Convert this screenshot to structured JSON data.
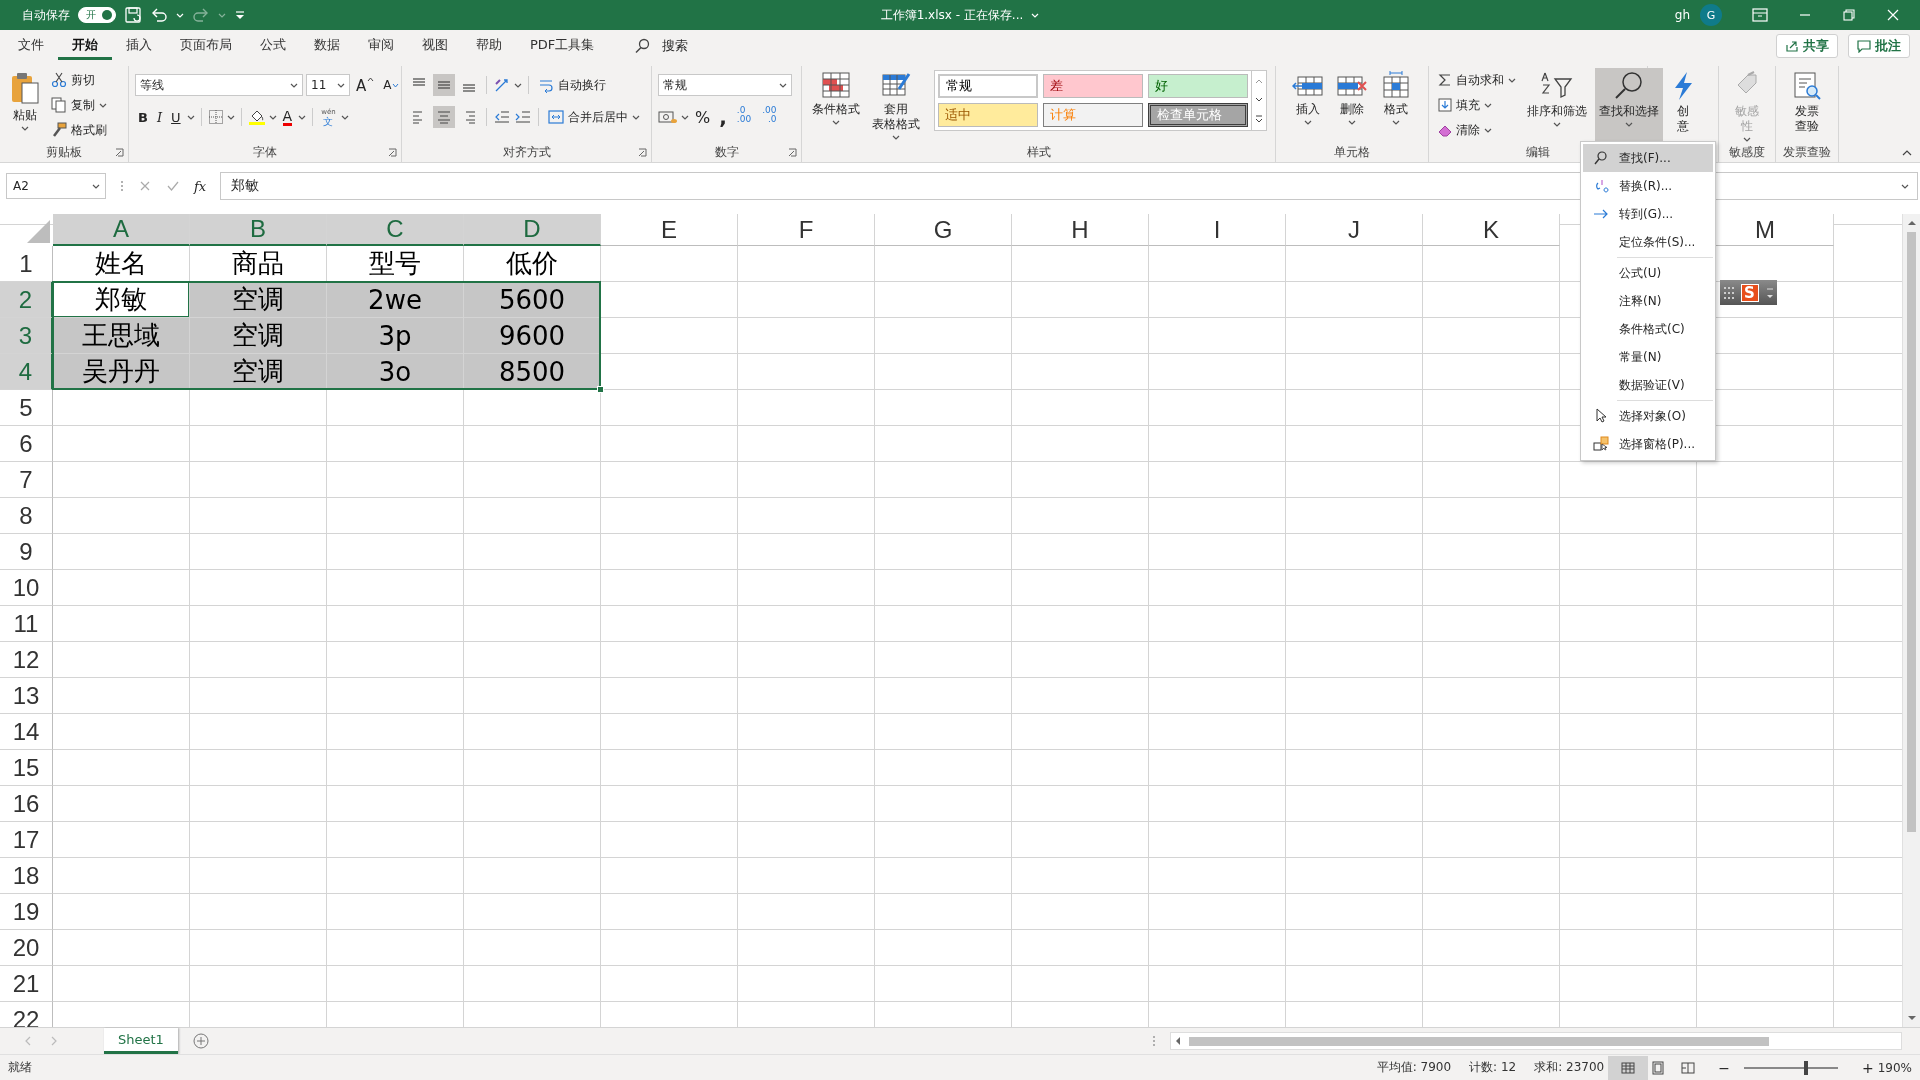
{
  "title_bar": {
    "autosave_label": "自动保存",
    "autosave_toggle": {
      "label": "开",
      "on": true
    },
    "redo_disabled": true,
    "title": "工作簿1.xlsx - 正在保存...",
    "user": "gh",
    "avatar": "G"
  },
  "tabs": [
    {
      "label": "文件",
      "selected": false
    },
    {
      "label": "开始",
      "selected": true
    },
    {
      "label": "插入",
      "selected": false
    },
    {
      "label": "页面布局",
      "selected": false
    },
    {
      "label": "公式",
      "selected": false
    },
    {
      "label": "数据",
      "selected": false
    },
    {
      "label": "审阅",
      "selected": false
    },
    {
      "label": "视图",
      "selected": false
    },
    {
      "label": "帮助",
      "selected": false
    },
    {
      "label": "PDF工具集",
      "selected": false
    }
  ],
  "search": {
    "label": "搜索"
  },
  "share_button": "共享",
  "comments_button": "批注",
  "ribbon": {
    "groups": [
      {
        "kind": "clipboard",
        "label": "剪贴板",
        "paste": "粘贴",
        "cut": "剪切",
        "copy": "复制",
        "format_painter": "格式刷"
      },
      {
        "kind": "font",
        "label": "字体",
        "font_name": "等线",
        "font_size": "11",
        "grow": "A",
        "shrink": "A",
        "bold": "B",
        "italic": "I",
        "underline": "U",
        "font_color": "A",
        "phonetic_top": "wén",
        "phonetic_bottom": "文"
      },
      {
        "kind": "alignment",
        "label": "对齐方式",
        "vertical": [
          {
            "selected": false
          },
          {
            "selected": true
          },
          {
            "selected": false
          }
        ],
        "horizontal": [
          {
            "selected": false
          },
          {
            "selected": true
          },
          {
            "selected": false
          }
        ],
        "wrap": "自动换行",
        "merge": "合并后居中"
      },
      {
        "kind": "number",
        "label": "数字",
        "format": "常规",
        "percent": "%",
        "comma": ",",
        "increase_decimal": {
          "top": ".0",
          "bottom": ".00"
        },
        "decrease_decimal": {
          "top": ".00",
          "bottom": ".0"
        }
      },
      {
        "kind": "styles",
        "label": "样式",
        "conditional": "条件格式",
        "table": [
          "套用",
          "表格格式"
        ],
        "cell_styles": [
          {
            "label": "常规",
            "kind": "normal"
          },
          {
            "label": "差",
            "kind": "bad"
          },
          {
            "label": "好",
            "kind": "good"
          },
          {
            "label": "适中",
            "kind": "neutral"
          },
          {
            "label": "计算",
            "kind": "calculation"
          },
          {
            "label": "检查单元格",
            "kind": "check"
          }
        ]
      },
      {
        "kind": "cells",
        "label": "单元格",
        "buttons": [
          "插入",
          "删除",
          "格式"
        ]
      },
      {
        "kind": "editing",
        "label": "编辑",
        "autosum": "自动求和",
        "fill": "填充",
        "clear": "清除",
        "sort": "排序和筛选",
        "find": {
          "label": "查找和选择",
          "expanded": true
        }
      },
      {
        "kind": "ideas",
        "button": [
          "创",
          "意"
        ]
      },
      {
        "kind": "sensitivity",
        "label": "敏感度",
        "button": {
          "lines": [
            "敏感",
            "性"
          ],
          "disabled": true
        }
      },
      {
        "kind": "invoice",
        "label": "发票查验",
        "button": [
          "发票",
          "查验"
        ]
      }
    ]
  },
  "formula_bar": {
    "name_box": "A2",
    "function_label": "fx",
    "content": "郑敏"
  },
  "sheet": {
    "columns": [
      "A",
      "B",
      "C",
      "D",
      "E",
      "F",
      "G",
      "H",
      "I",
      "J",
      "K",
      null,
      "M"
    ],
    "rows": [
      {
        "label": "1",
        "selected": false,
        "cells": [
          {
            "text": "姓名",
            "selected": false,
            "active": false
          },
          {
            "text": "商品",
            "selected": false,
            "active": false
          },
          {
            "text": "型号",
            "selected": false,
            "active": false
          },
          {
            "text": "低价",
            "selected": false,
            "active": false
          }
        ]
      },
      {
        "label": "2",
        "selected": true,
        "cells": [
          {
            "text": "郑敏",
            "selected": true,
            "active": true
          },
          {
            "text": "空调",
            "selected": true,
            "active": false
          },
          {
            "text": "2we",
            "selected": true,
            "active": false
          },
          {
            "text": "5600",
            "selected": true,
            "active": false
          }
        ]
      },
      {
        "label": "3",
        "selected": true,
        "cells": [
          {
            "text": "王思域",
            "selected": true,
            "active": false
          },
          {
            "text": "空调",
            "selected": true,
            "active": false
          },
          {
            "text": "3p",
            "selected": true,
            "active": false
          },
          {
            "text": "9600",
            "selected": true,
            "active": false
          }
        ]
      },
      {
        "label": "4",
        "selected": true,
        "cells": [
          {
            "text": "吴丹丹",
            "selected": true,
            "active": false
          },
          {
            "text": "空调",
            "selected": true,
            "active": false
          },
          {
            "text": "3o",
            "selected": true,
            "active": false
          },
          {
            "text": "8500",
            "selected": true,
            "active": false
          }
        ]
      },
      {
        "label": "5",
        "selected": false
      },
      {
        "label": "6",
        "selected": false
      },
      {
        "label": "7",
        "selected": false
      },
      {
        "label": "8",
        "selected": false
      },
      {
        "label": "9",
        "selected": false
      },
      {
        "label": "10",
        "selected": false
      },
      {
        "label": "11",
        "selected": false
      },
      {
        "label": "12",
        "selected": false
      },
      {
        "label": "13",
        "selected": false
      },
      {
        "label": "14",
        "selected": false
      },
      {
        "label": "15",
        "selected": false
      },
      {
        "label": "16",
        "selected": false
      },
      {
        "label": "17",
        "selected": false
      },
      {
        "label": "18",
        "selected": false
      },
      {
        "label": "19",
        "selected": false
      },
      {
        "label": "20",
        "selected": false
      },
      {
        "label": "21",
        "selected": false
      },
      {
        "label": "22",
        "selected": false
      }
    ]
  },
  "find_menu": {
    "sections": [
      [
        {
          "label": "查找(F)...",
          "selected": true
        },
        {
          "label": "替换(R)...",
          "selected": false
        },
        {
          "label": "转到(G)...",
          "selected": false
        },
        {
          "label": "定位条件(S)...",
          "selected": false
        }
      ],
      [
        {
          "label": "公式(U)",
          "selected": false
        },
        {
          "label": "注释(N)",
          "selected": false
        },
        {
          "label": "条件格式(C)",
          "selected": false
        },
        {
          "label": "常量(N)",
          "selected": false
        },
        {
          "label": "数据验证(V)",
          "selected": false
        }
      ],
      [
        {
          "label": "选择对象(O)",
          "selected": false
        },
        {
          "label": "选择窗格(P)...",
          "selected": false
        }
      ]
    ]
  },
  "ime_toolbar": {
    "logo": "S"
  },
  "sheet_tabs": [
    {
      "label": "Sheet1",
      "selected": true
    }
  ],
  "status_bar": {
    "status": "就绪",
    "average": "平均值: 7900",
    "count": "计数: 12",
    "sum": "求和: 23700",
    "views": [
      {
        "selected": true
      },
      {
        "selected": false
      },
      {
        "selected": false
      }
    ],
    "zoom_out": "−",
    "zoom": {
      "level": 0.64
    },
    "zoom_in": "+",
    "zoom_label": "190%"
  }
}
